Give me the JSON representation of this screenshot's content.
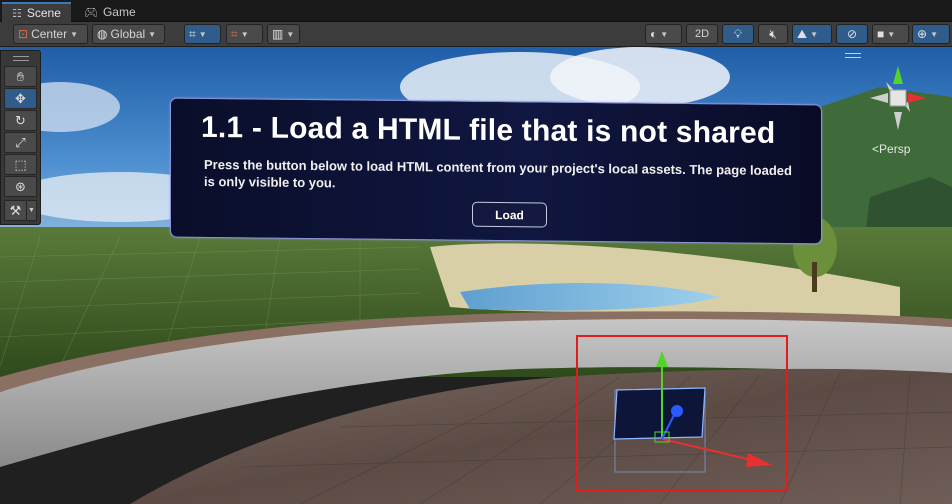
{
  "tabs": [
    {
      "label": "Scene",
      "icon": "scene-grid-icon",
      "active": true
    },
    {
      "label": "Game",
      "icon": "gamepad-icon",
      "active": false
    }
  ],
  "toolbar": {
    "pivot_label": "Center",
    "space_label": "Global",
    "mode_2d_label": "2D"
  },
  "panel": {
    "title": "1.1 - Load a HTML file that is not shared",
    "description": "Press the button below to load HTML content from your project's local assets. The page loaded is only visible to you.",
    "button_label": "Load"
  },
  "gizmo": {
    "view_label": "Persp"
  },
  "colors": {
    "accent": "#2f5c8a",
    "selection": "#e21b1b",
    "panel_bg": "#0e143a",
    "axis_x": "#e83030",
    "axis_y": "#56d32a",
    "axis_z": "#2a5bff"
  }
}
